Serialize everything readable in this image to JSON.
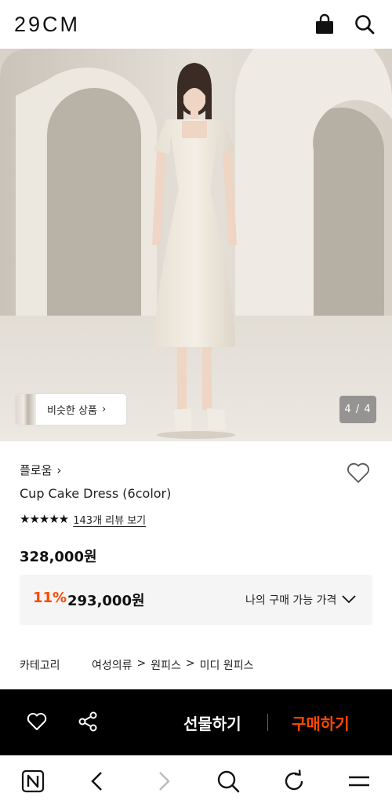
{
  "header": {
    "logo": "29CM",
    "icons": [
      "shopping-bag-icon",
      "search-icon"
    ]
  },
  "gallery": {
    "similar_button": "비슷한 상품",
    "counter": "4 / 4"
  },
  "product": {
    "brand": "플로움",
    "title": "Cup Cake Dress (6color)",
    "rating_stars": 5,
    "stars_text": "★★★★★",
    "review_link": "143개 리뷰 보기",
    "original_price": "328,000원",
    "discount": "11%",
    "sale_price": "293,000원",
    "my_price_label": "나의 구매 가능 가격"
  },
  "category": {
    "label": "카테고리",
    "path": [
      "여성의류",
      "원피스",
      "미디 원피스"
    ],
    "separator": ">"
  },
  "action_bar": {
    "gift_label": "선물하기",
    "buy_label": "구매하기",
    "accent_color": "#ff4800"
  },
  "browser_bar": {
    "icons": [
      "naver-home-icon",
      "back-icon",
      "forward-icon",
      "search-icon",
      "refresh-icon",
      "menu-icon"
    ]
  }
}
